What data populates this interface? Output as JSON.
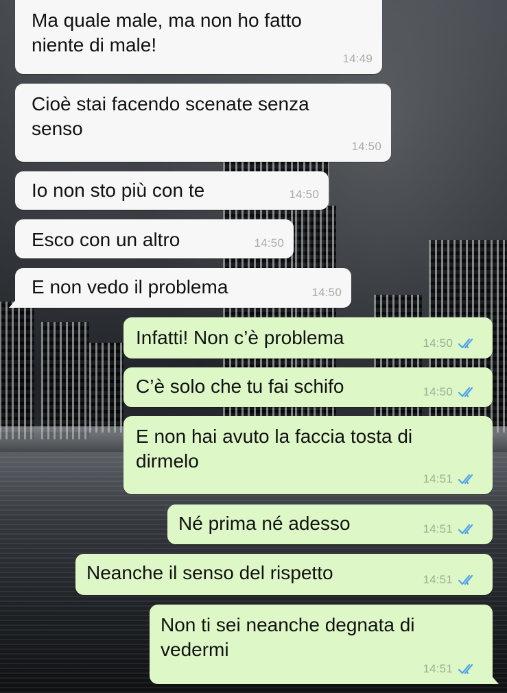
{
  "messages": [
    {
      "direction": "incoming",
      "text": "Ma quale male, ma non ho fatto\nniente di male!",
      "time": "14:49",
      "read": false
    },
    {
      "direction": "incoming",
      "text": "Cioè stai facendo scenate senza\nsenso",
      "time": "14:50",
      "read": false
    },
    {
      "direction": "incoming",
      "text": "Io non sto più con te",
      "time": "14:50",
      "read": false
    },
    {
      "direction": "incoming",
      "text": "Esco con un altro",
      "time": "14:50",
      "read": false
    },
    {
      "direction": "incoming",
      "text": "E non vedo il problema",
      "time": "14:50",
      "read": false
    },
    {
      "direction": "outgoing",
      "text": "Infatti! Non c’è problema",
      "time": "14:50",
      "read": true
    },
    {
      "direction": "outgoing",
      "text": "C’è solo che tu fai schifo",
      "time": "14:50",
      "read": true
    },
    {
      "direction": "outgoing",
      "text": "E non hai avuto la faccia tosta di\ndirmelo",
      "time": "14:51",
      "read": true
    },
    {
      "direction": "outgoing",
      "text": "Né prima né adesso",
      "time": "14:51",
      "read": true
    },
    {
      "direction": "outgoing",
      "text": "Neanche il senso del rispetto",
      "time": "14:51",
      "read": true
    },
    {
      "direction": "outgoing",
      "text": "Non ti sei neanche degnata di\nvedermi",
      "time": "14:51",
      "read": true
    }
  ],
  "colors": {
    "incoming_bubble": "#f7f7f7",
    "outgoing_bubble": "#def7c7",
    "read_ticks": "#4fa3e8"
  },
  "icons": {
    "read_receipt": "double-check-icon"
  }
}
